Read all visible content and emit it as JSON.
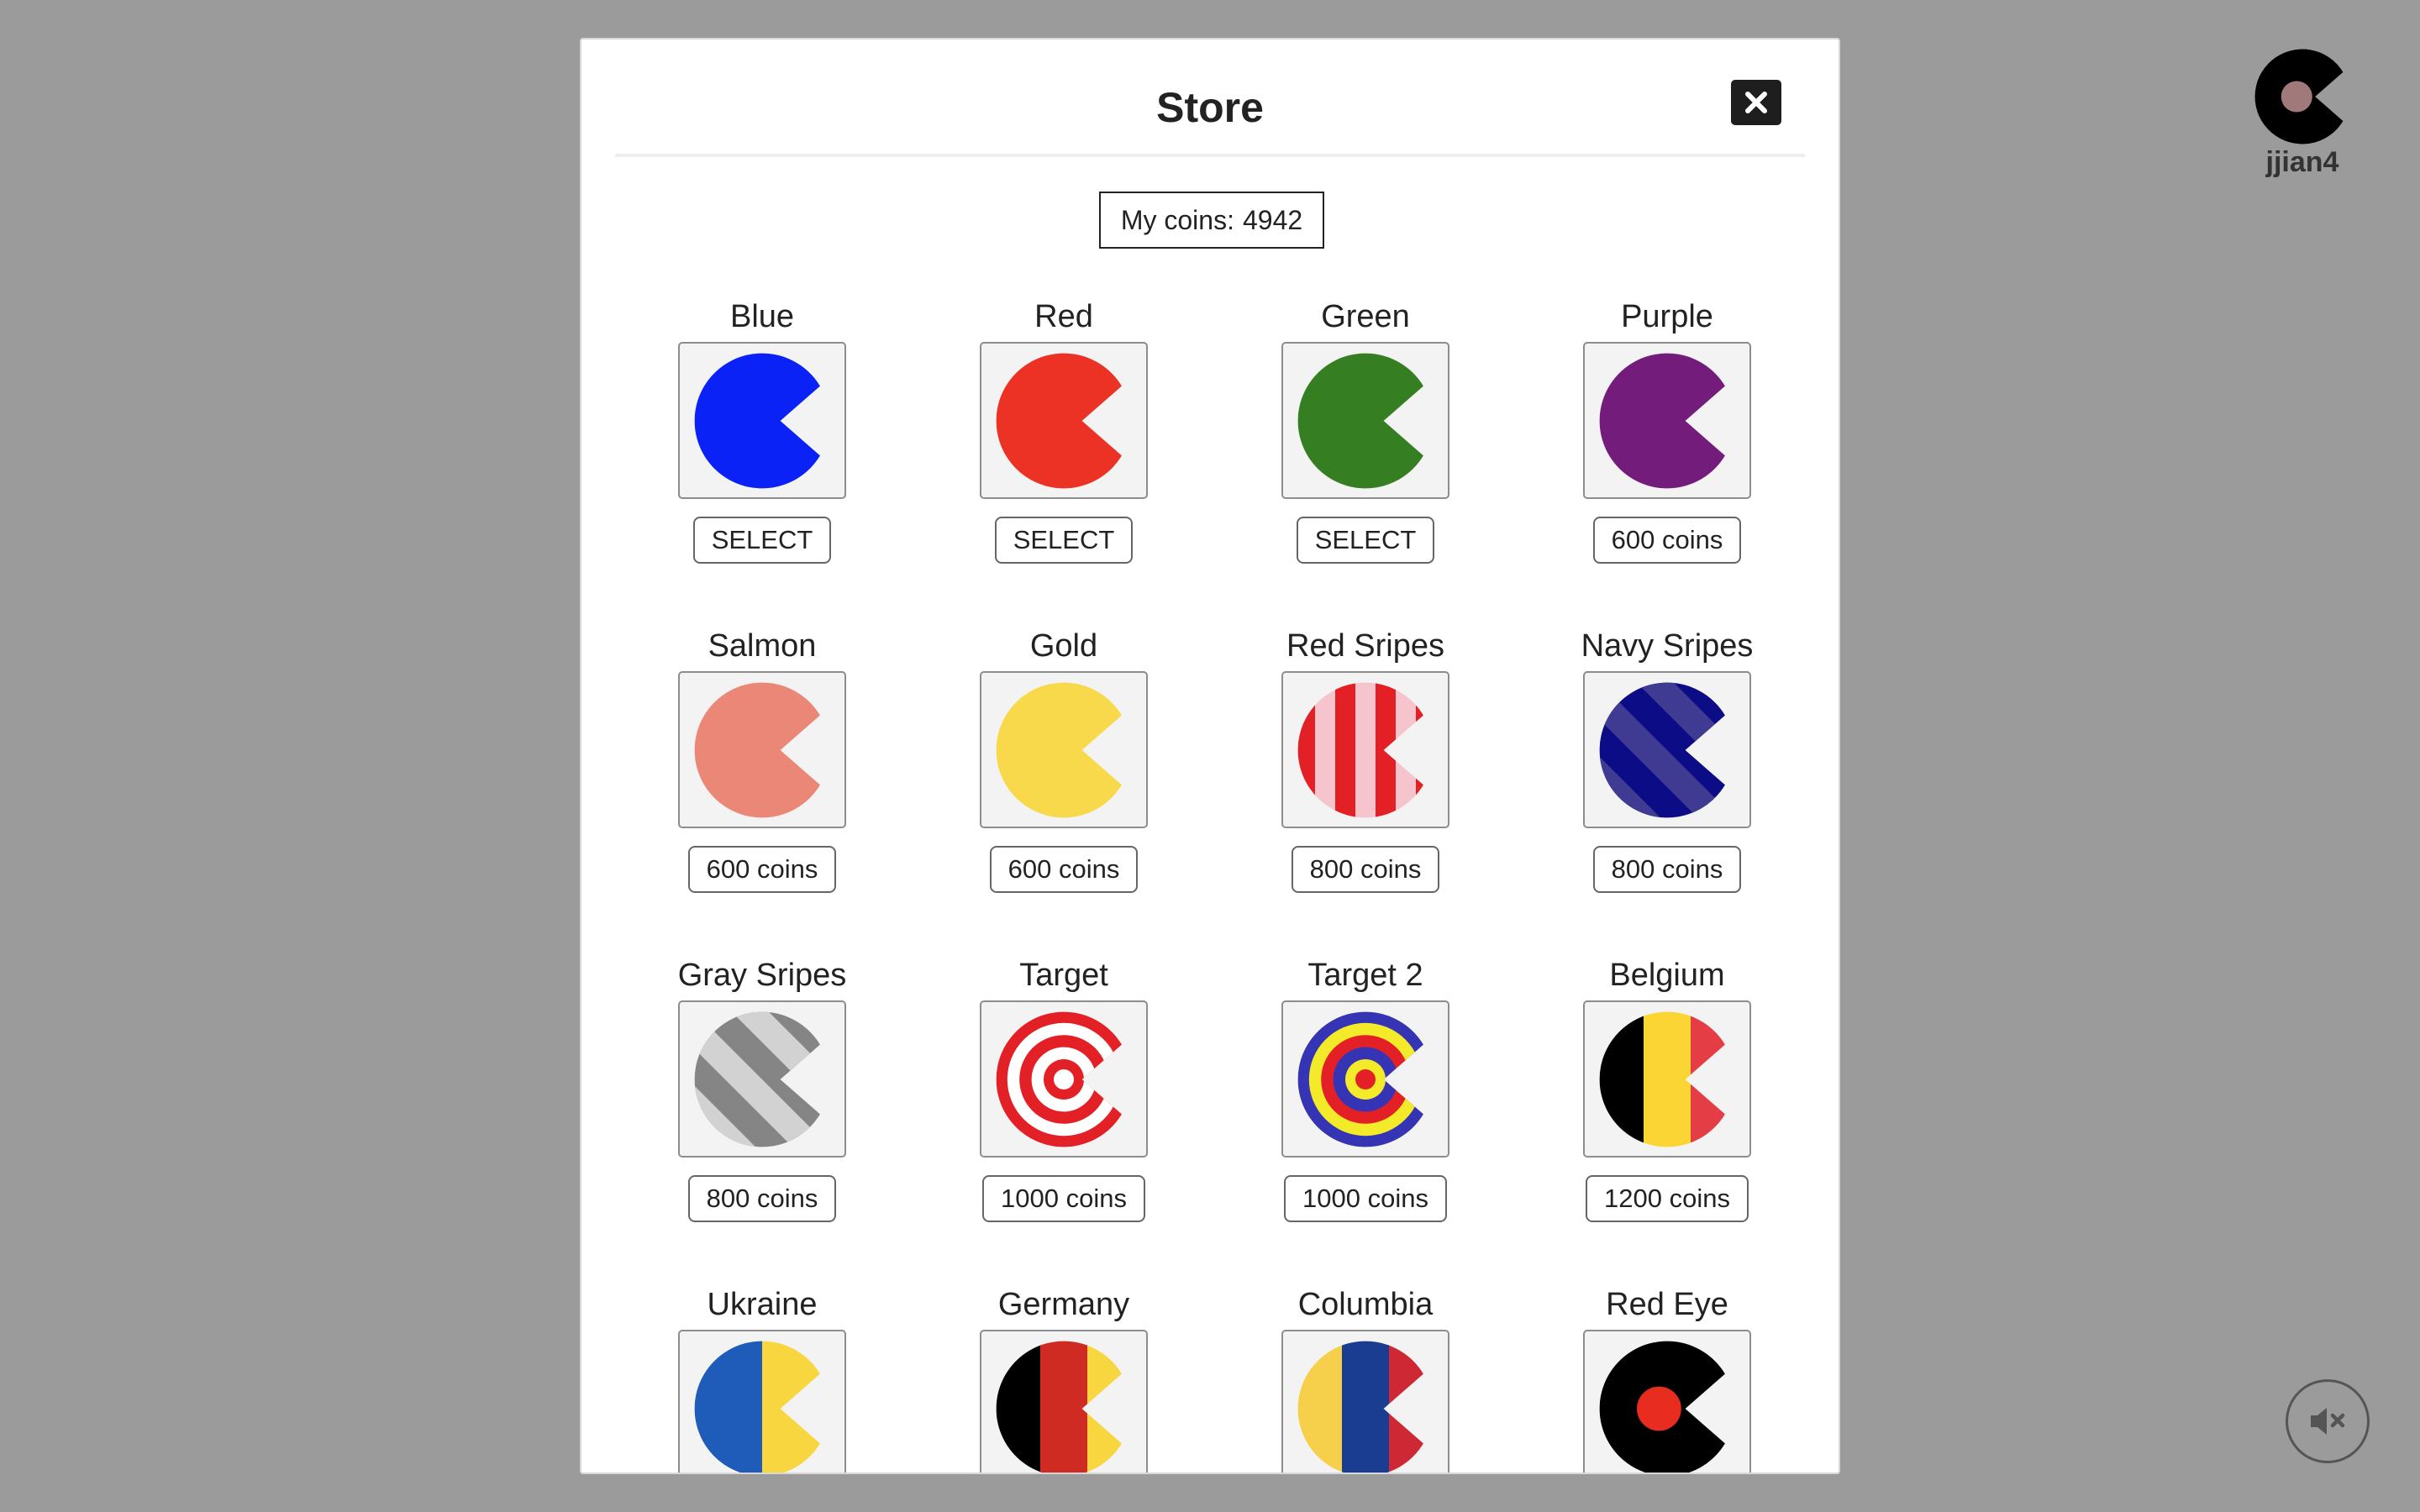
{
  "store": {
    "title": "Store",
    "coins_label": "My coins:",
    "coins_value": "4942"
  },
  "user": {
    "username": "jjian4"
  },
  "items": [
    {
      "name": "Blue",
      "button": "SELECT",
      "skin": "solid",
      "colors": [
        "#0a22f5"
      ]
    },
    {
      "name": "Red",
      "button": "SELECT",
      "skin": "solid",
      "colors": [
        "#ec3225"
      ]
    },
    {
      "name": "Green",
      "button": "SELECT",
      "skin": "solid",
      "colors": [
        "#367e22"
      ]
    },
    {
      "name": "Purple",
      "button": "600 coins",
      "skin": "solid",
      "colors": [
        "#741c7b"
      ]
    },
    {
      "name": "Salmon",
      "button": "600 coins",
      "skin": "solid",
      "colors": [
        "#eb8777"
      ]
    },
    {
      "name": "Gold",
      "button": "600 coins",
      "skin": "solid",
      "colors": [
        "#f8d94b"
      ]
    },
    {
      "name": "Red Sripes",
      "button": "800 coins",
      "skin": "vstripes",
      "colors": [
        "#e32025",
        "#f6c4cc"
      ]
    },
    {
      "name": "Navy Sripes",
      "button": "800 coins",
      "skin": "dstripes",
      "colors": [
        "#0c0c86",
        "#3f3a92"
      ]
    },
    {
      "name": "Gray Sripes",
      "button": "800 coins",
      "skin": "dstripes",
      "colors": [
        "#858585",
        "#d2d2d2"
      ]
    },
    {
      "name": "Target",
      "button": "1000 coins",
      "skin": "rings",
      "colors": [
        "#e32025",
        "#ffffff"
      ]
    },
    {
      "name": "Target 2",
      "button": "1000 coins",
      "skin": "rings",
      "colors": [
        "#3434b4",
        "#f3ea2a",
        "#e32025"
      ]
    },
    {
      "name": "Belgium",
      "button": "1200 coins",
      "skin": "flag",
      "colors": [
        "#000000",
        "#fad534",
        "#e53d45"
      ]
    },
    {
      "name": "Ukraine",
      "button": "",
      "skin": "flag2",
      "colors": [
        "#1f5bb8",
        "#f8d63f"
      ]
    },
    {
      "name": "Germany",
      "button": "",
      "skin": "flag",
      "colors": [
        "#000000",
        "#d02b22",
        "#f8d63f"
      ]
    },
    {
      "name": "Columbia",
      "button": "",
      "skin": "flag",
      "colors": [
        "#f6d04a",
        "#1a3d92",
        "#cf2835"
      ]
    },
    {
      "name": "Red Eye",
      "button": "",
      "skin": "eye",
      "colors": [
        "#000000",
        "#e82d20"
      ]
    }
  ],
  "icons": {
    "close": "close-icon",
    "mute": "mute-speaker-icon",
    "avatar": "pacman-avatar-icon"
  },
  "avatar_colors": [
    "#000000",
    "#a07a7a"
  ]
}
